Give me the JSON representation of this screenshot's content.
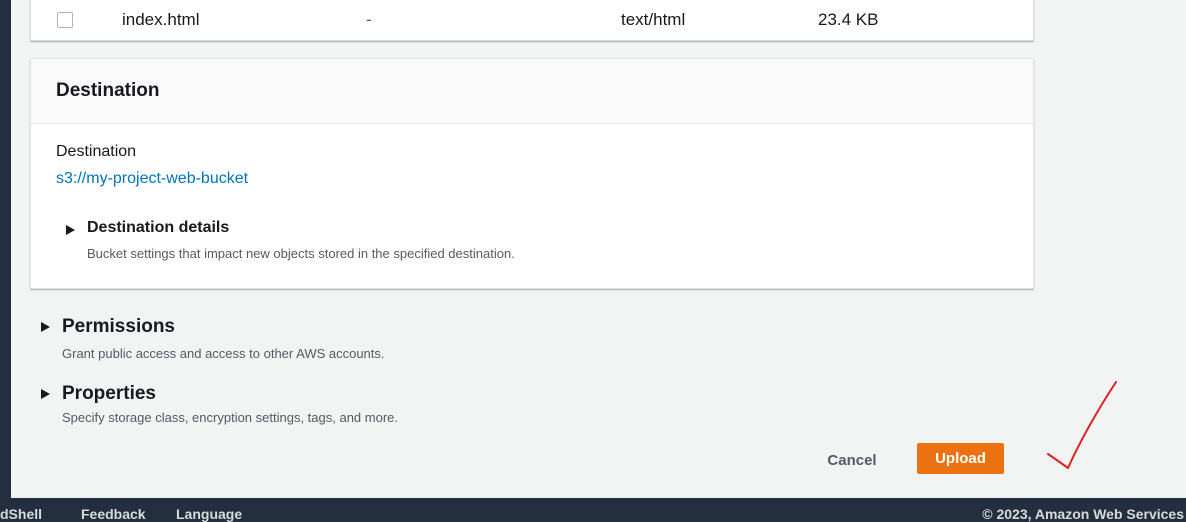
{
  "file_row": {
    "name": "index.html",
    "folder": "-",
    "type": "text/html",
    "size": "23.4 KB"
  },
  "destination": {
    "header": "Destination",
    "label": "Destination",
    "link": "s3://my-project-web-bucket",
    "details_title": "Destination details",
    "details_desc": "Bucket settings that impact new objects stored in the specified destination."
  },
  "permissions": {
    "title": "Permissions",
    "desc": "Grant public access and access to other AWS accounts."
  },
  "properties": {
    "title": "Properties",
    "desc": "Specify storage class, encryption settings, tags, and more."
  },
  "actions": {
    "cancel": "Cancel",
    "upload": "Upload",
    "upload_color": "#ec7211"
  },
  "footer": {
    "links": [
      "dShell",
      "Feedback",
      "Language"
    ],
    "copyright": "© 2023, Amazon Web Services"
  },
  "annotation": {
    "checkmark_color": "#e02020"
  }
}
